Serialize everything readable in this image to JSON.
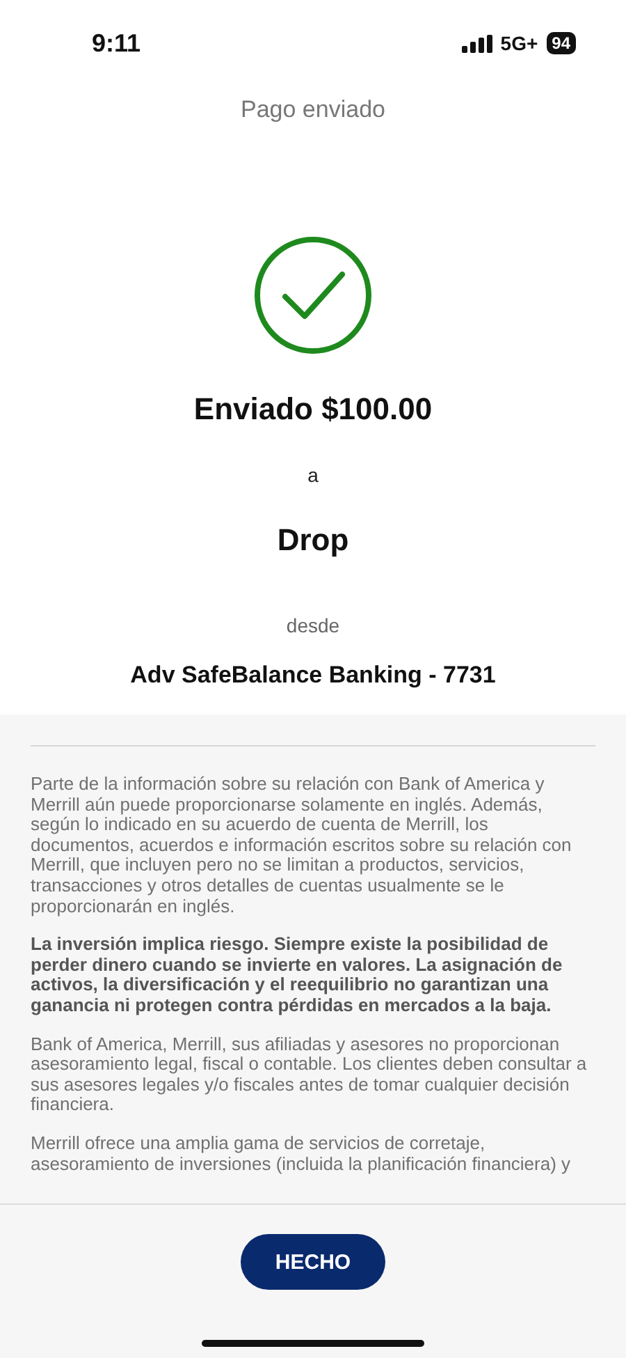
{
  "status_bar": {
    "time": "9:11",
    "network": "5G+",
    "battery": "94"
  },
  "header": {
    "title": "Pago enviado"
  },
  "confirmation": {
    "amount_line": "Enviado $100.00",
    "connector": "a",
    "recipient": "Drop",
    "from_label": "desde",
    "account": "Adv SafeBalance Banking - 7731"
  },
  "disclosures": [
    {
      "kind": "plain",
      "text": "Parte de la información sobre su relación con Bank of America y Merrill aún puede proporcionarse solamente en inglés. Además, según lo indicado en su acuerdo de cuenta de Merrill, los documentos, acuerdos e información escritos sobre su relación con Merrill, que incluyen pero no se limitan a productos, servicios, transacciones y otros detalles de cuentas usualmente se le proporcionarán en inglés."
    },
    {
      "kind": "bold",
      "text": "La inversión implica riesgo. Siempre existe la posibilidad de perder dinero cuando se invierte en valores. La asignación de activos, la diversificación y el reequilibrio no garantizan una ganancia ni protegen contra pérdidas en mercados a la baja."
    },
    {
      "kind": "plain",
      "text": "Bank of America, Merrill, sus afiliadas y asesores no proporcionan asesoramiento legal, fiscal o contable. Los clientes deben consultar a sus asesores legales y/o fiscales antes de tomar cualquier decisión financiera."
    },
    {
      "kind": "plain",
      "text": "Merrill ofrece una amplia gama de servicios de corretaje, asesoramiento de inversiones (incluida la planificación financiera) y"
    }
  ],
  "footer": {
    "button": "HECHO"
  }
}
